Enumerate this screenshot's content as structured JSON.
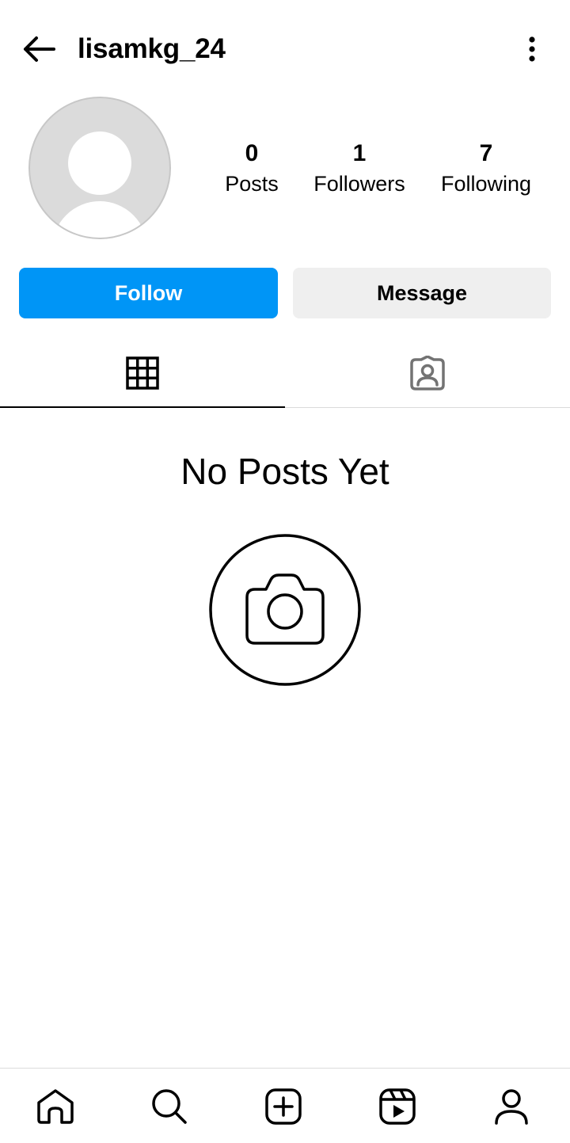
{
  "header": {
    "username": "lisamkg_24",
    "back_icon": "arrow-left-icon",
    "more_icon": "more-vertical-icon"
  },
  "profile": {
    "avatar_icon": "default-avatar-icon",
    "stats": [
      {
        "value": "0",
        "label": "Posts"
      },
      {
        "value": "1",
        "label": "Followers"
      },
      {
        "value": "7",
        "label": "Following"
      }
    ]
  },
  "actions": {
    "follow_label": "Follow",
    "message_label": "Message"
  },
  "tabs": [
    {
      "icon": "grid-icon",
      "active": true
    },
    {
      "icon": "tagged-icon",
      "active": false
    }
  ],
  "empty_state": {
    "title": "No Posts Yet",
    "icon": "camera-icon"
  },
  "bottom_nav": [
    {
      "icon": "home-icon"
    },
    {
      "icon": "search-icon"
    },
    {
      "icon": "create-icon"
    },
    {
      "icon": "reels-icon"
    },
    {
      "icon": "profile-icon"
    }
  ],
  "colors": {
    "accent": "#0095f6",
    "secondary_button": "#efefef",
    "divider": "#dbdbdb",
    "avatar_bg": "#dbdbdb"
  }
}
